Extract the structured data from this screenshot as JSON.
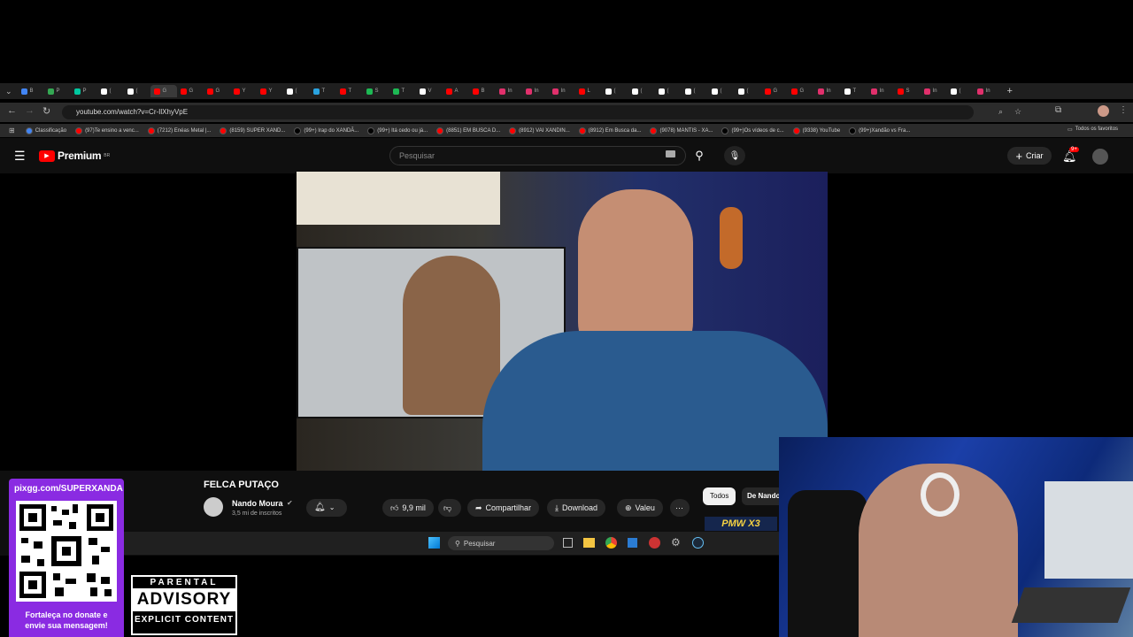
{
  "browser": {
    "tabs": [
      "B",
      "P",
      "P",
      "(",
      "(",
      "G",
      "G",
      "G",
      "Y",
      "Y",
      "(",
      "T",
      "T",
      "S",
      "T",
      "V",
      "A",
      "B",
      "In",
      "In",
      "In",
      "L",
      "(",
      "(",
      "(",
      "(",
      "(",
      "(",
      "G",
      "G",
      "In",
      "T",
      "In",
      "S",
      "In",
      "(",
      "In"
    ],
    "url": "youtube.com/watch?v=Cr-IlXhyVpE",
    "bookmarks": [
      {
        "label": "Classificação",
        "color": "#4285f4"
      },
      {
        "label": "(97)Te ensino a venc...",
        "color": "#ff0000"
      },
      {
        "label": "(7212) Enéas Metal |...",
        "color": "#ff0000"
      },
      {
        "label": "(8159) SUPER XAND...",
        "color": "#ff0000"
      },
      {
        "label": "(99+) Irap do XANDÃ...",
        "color": "#000000"
      },
      {
        "label": "(99+) Itá cedo ou já...",
        "color": "#000000"
      },
      {
        "label": "(8851) EM BUSCA D...",
        "color": "#ff0000"
      },
      {
        "label": "(8912) VAI XANDIN...",
        "color": "#ff0000"
      },
      {
        "label": "(8912) Em Busca da...",
        "color": "#ff0000"
      },
      {
        "label": "(9078) MANTIS - XA...",
        "color": "#ff0000"
      },
      {
        "label": "(99+)Os vídeos de c...",
        "color": "#000000"
      },
      {
        "label": "(9338) YouTube",
        "color": "#ff0000"
      },
      {
        "label": "(99+)Xandão vs Fra...",
        "color": "#000000"
      }
    ],
    "all_favorites": "Todos os favoritos"
  },
  "youtube": {
    "logo_text": "Premium",
    "logo_badge": "BR",
    "search_placeholder": "Pesquisar",
    "create_label": "Criar",
    "notif_count": "9+",
    "video_title": "FELCA PUTAÇO",
    "channel_name": "Nando Moura",
    "subscribers": "3,5 mi de inscritos",
    "likes": "9,9 mil",
    "share_label": "Compartilhar",
    "download_label": "Download",
    "thanks_label": "Valeu",
    "chip_all": "Todos",
    "chip_from": "De Nando"
  },
  "taskbar": {
    "search_placeholder": "Pesquisar"
  },
  "overlay": {
    "pix_url": "pixgg.com/SUPERXANDA",
    "pix_cta_line1": "Fortaleça no donate e",
    "pix_cta_line2": "envie sua mensagem!",
    "advisory_top": "PARENTAL",
    "advisory_mid": "ADVISORY",
    "advisory_bot": "EXPLICIT CONTENT",
    "sponsor_logo": "PMW X3"
  },
  "colors": {
    "yt_red": "#ff0000",
    "pix_purple": "#8a2be2",
    "like_blue": "#3ea6ff"
  }
}
